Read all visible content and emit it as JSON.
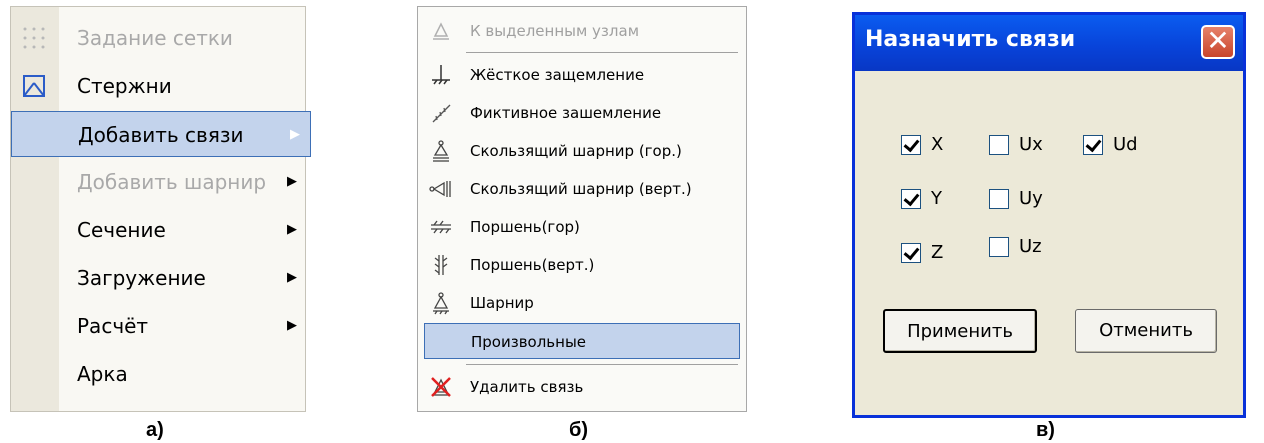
{
  "menu_a": {
    "items": [
      {
        "label": "Задание сетки",
        "disabled": true,
        "icon": "grid-dots-icon"
      },
      {
        "label": "Стержни",
        "disabled": false,
        "icon": "truss-icon"
      },
      {
        "label": "Добавить связи",
        "disabled": false,
        "selected": true,
        "submenu": true
      },
      {
        "label": "Добавить шарнир",
        "disabled": true,
        "submenu": true
      },
      {
        "label": "Сечение",
        "disabled": false,
        "submenu": true
      },
      {
        "label": "Загружение",
        "disabled": false,
        "submenu": true
      },
      {
        "label": "Расчёт",
        "disabled": false,
        "submenu": true
      },
      {
        "label": "Арка",
        "disabled": false
      }
    ],
    "arrow": "▶",
    "caption": "а)"
  },
  "menu_b": {
    "items": [
      {
        "label": "К выделенным узлам",
        "disabled": true,
        "icon": "pin-support-disabled-icon"
      },
      {
        "label": "Жёсткое защемление",
        "icon": "fixed-support-icon"
      },
      {
        "label": "Фиктивное зашемление",
        "icon": "fictive-fixed-support-icon"
      },
      {
        "label": "Скользящий шарнир (гор.)",
        "icon": "sliding-hinge-horizontal-icon"
      },
      {
        "label": "Скользящий шарнир (верт.)",
        "icon": "sliding-hinge-vertical-icon"
      },
      {
        "label": "Поршень(гор)",
        "icon": "piston-horizontal-icon"
      },
      {
        "label": "Поршень(верт.)",
        "icon": "piston-vertical-icon"
      },
      {
        "label": "Шарнир",
        "icon": "hinge-icon"
      },
      {
        "label": "Произвольные",
        "selected": true
      },
      {
        "label": "Удалить связь",
        "icon": "delete-support-icon"
      }
    ],
    "caption": "б)"
  },
  "dialog": {
    "title": "Назначить связи",
    "close_glyph": "✕",
    "checkboxes": [
      {
        "label": "X",
        "checked": true
      },
      {
        "label": "Ux",
        "checked": false
      },
      {
        "label": "Ud",
        "checked": true
      },
      {
        "label": "Y",
        "checked": true
      },
      {
        "label": "Uy",
        "checked": false
      },
      {
        "label": "Z",
        "checked": true
      },
      {
        "label": "Uz",
        "checked": false
      }
    ],
    "apply_label": "Применить",
    "cancel_label": "Отменить",
    "caption": "в)"
  },
  "colors": {
    "selection_bg": "#c3d3ec",
    "selection_border": "#3d6fb6",
    "titlebar": "#0842d8",
    "dialog_bg": "#ece9d8"
  }
}
